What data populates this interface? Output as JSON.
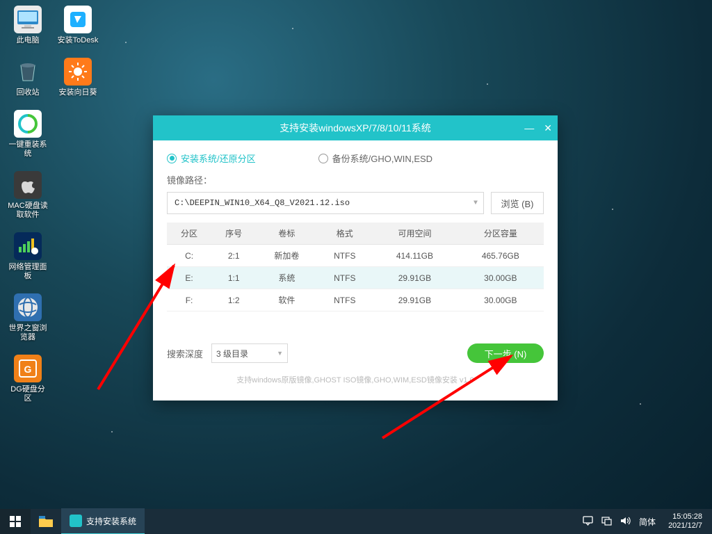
{
  "desktop_col1": [
    {
      "label": "此电脑",
      "name": "this-pc",
      "bg": "#eaeaea",
      "svg": "pc"
    },
    {
      "label": "回收站",
      "name": "recycle-bin",
      "bg": "transparent",
      "svg": "bin"
    },
    {
      "label": "一键重装系统",
      "name": "reinstall-system",
      "bg": "#fff",
      "svg": "reinst"
    },
    {
      "label": "MAC硬盘读取软件",
      "name": "mac-disk-reader",
      "bg": "#3a3a3a",
      "svg": "apple"
    },
    {
      "label": "网络管理面板",
      "name": "network-panel",
      "bg": "#052a5a",
      "svg": "net"
    },
    {
      "label": "世界之窗浏览器",
      "name": "theworld-browser",
      "bg": "#2f6fb0",
      "svg": "globe"
    },
    {
      "label": "DG硬盘分区",
      "name": "diskgenius",
      "bg": "#f08018",
      "svg": "dg"
    }
  ],
  "desktop_col2": [
    {
      "label": "安装ToDesk",
      "name": "install-todesk",
      "bg": "#fff",
      "svg": "todesk"
    },
    {
      "label": "安装向日葵",
      "name": "install-sunlogin",
      "bg": "#ff7a1a",
      "svg": "sun"
    }
  ],
  "window": {
    "title": "支持安装windowsXP/7/8/10/11系统",
    "radio_install": "安装系统/还原分区",
    "radio_backup": "备份系统/GHO,WIN,ESD",
    "path_label": "镜像路径：",
    "path_value": "C:\\DEEPIN_WIN10_X64_Q8_V2021.12.iso",
    "browse": "浏览 (B)",
    "headers": [
      "分区",
      "序号",
      "卷标",
      "格式",
      "可用空间",
      "分区容量"
    ],
    "rows": [
      [
        "C:",
        "2:1",
        "新加卷",
        "NTFS",
        "414.11GB",
        "465.76GB"
      ],
      [
        "E:",
        "1:1",
        "系统",
        "NTFS",
        "29.91GB",
        "30.00GB"
      ],
      [
        "F:",
        "1:2",
        "软件",
        "NTFS",
        "29.91GB",
        "30.00GB"
      ]
    ],
    "selected_row": 1,
    "depth_label": "搜索深度",
    "depth_value": "3 级目录",
    "next": "下一步 (N)",
    "subtitle": "支持windows原版镜像,GHOST ISO镜像,GHO,WIM,ESD镜像安装 v1.0"
  },
  "taskbar": {
    "task_label": "支持安装系统",
    "ime": "简体",
    "time": "15:05:28",
    "date": "2021/12/7"
  }
}
